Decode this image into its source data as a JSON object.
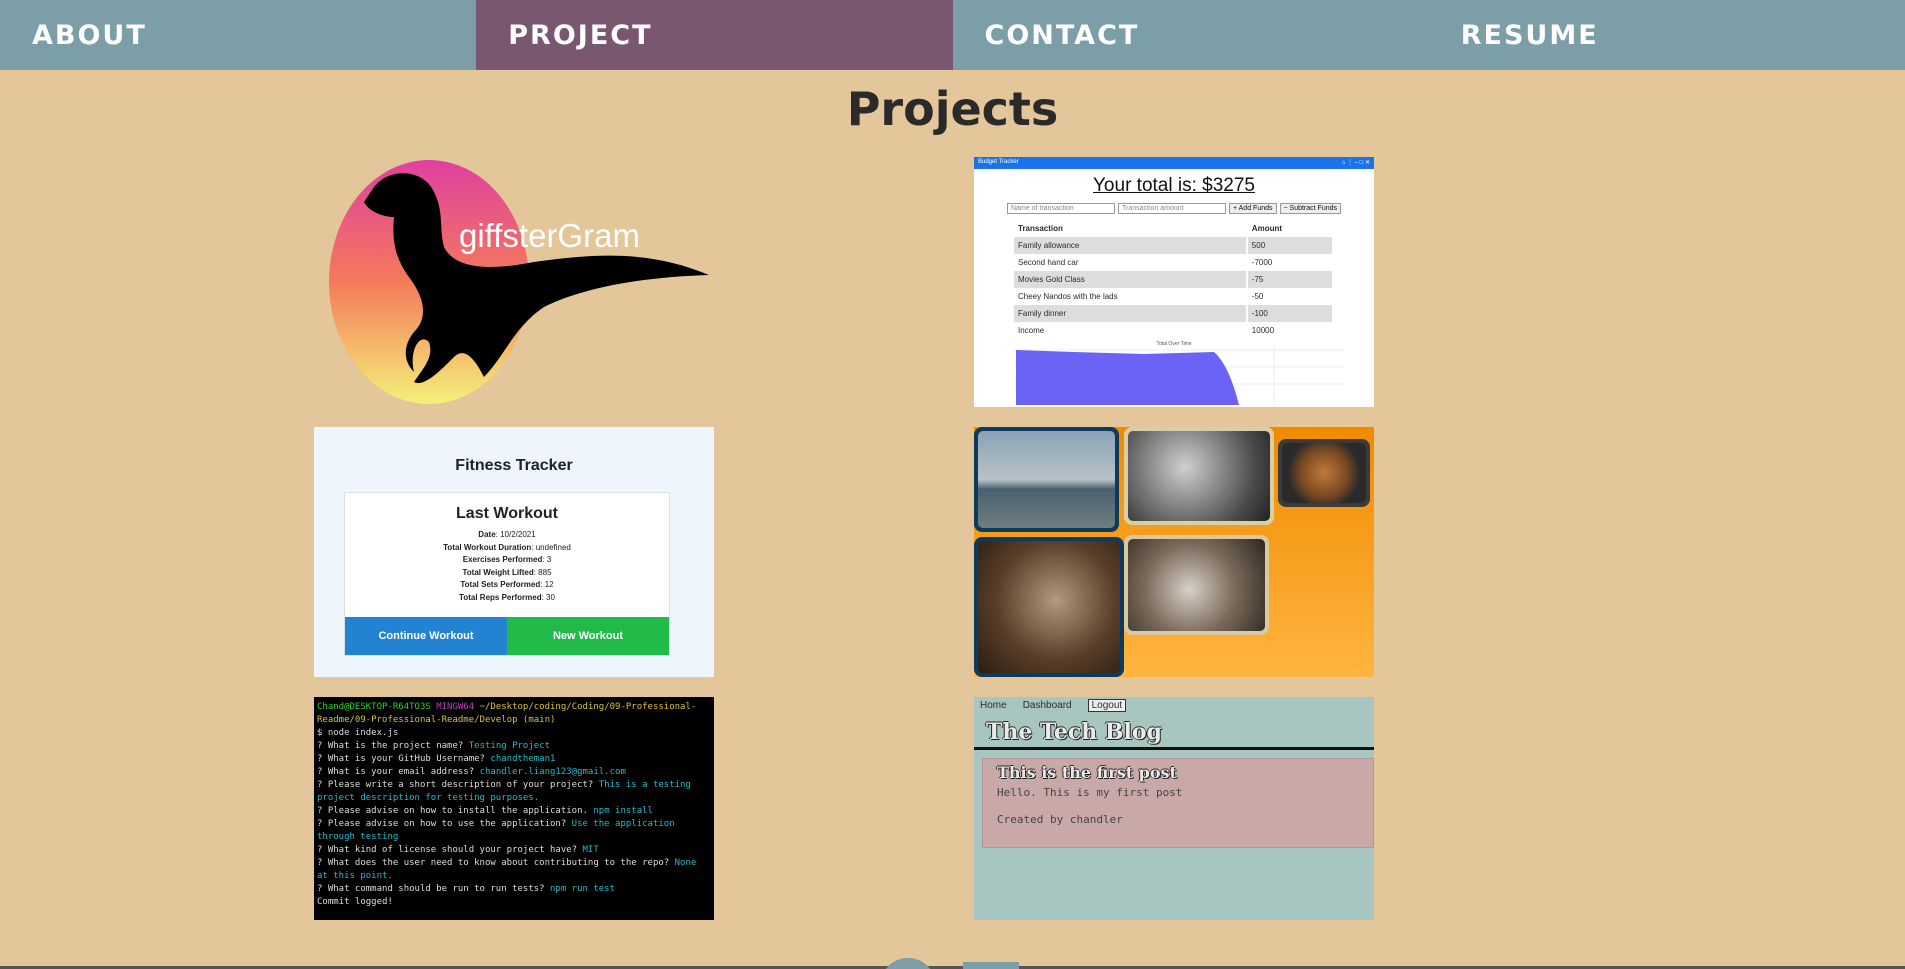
{
  "nav": {
    "items": [
      {
        "label": "ABOUT"
      },
      {
        "label": "PROJECT"
      },
      {
        "label": "CONTACT"
      },
      {
        "label": "RESUME"
      }
    ]
  },
  "page": {
    "title": "Projects"
  },
  "colors": {
    "nav_bg": "#7B9EA8",
    "nav_active": "#7A5770",
    "page_bg": "#E3C699"
  },
  "projects": {
    "giffstergram": {
      "logo_text": "giffsterGram"
    },
    "budget": {
      "window_title": "Budget Tracker",
      "total": "Your total is: $3275",
      "name_placeholder": "Name of transaction",
      "amount_placeholder": "Transaction amount",
      "add_label": "+ Add Funds",
      "subtract_label": "− Subtract Funds",
      "headers": [
        "Transaction",
        "Amount"
      ],
      "rows": [
        [
          "Family allowance",
          "500"
        ],
        [
          "Second hand car",
          "-7000"
        ],
        [
          "Movies Gold Class",
          "-75"
        ],
        [
          "Cheey Nandos with the lads",
          "-50"
        ],
        [
          "Family dinner",
          "-100"
        ],
        [
          "Income",
          "10000"
        ]
      ],
      "legend": "Total Over Time"
    },
    "fitness": {
      "title": "Fitness Tracker",
      "card_title": "Last Workout",
      "stats": [
        {
          "label": "Date",
          "value": "10/2/2021"
        },
        {
          "label": "Total Workout Duration",
          "value": "undefined"
        },
        {
          "label": "Exercises Performed",
          "value": "3"
        },
        {
          "label": "Total Weight Lifted",
          "value": "885"
        },
        {
          "label": "Total Sets Performed",
          "value": "12"
        },
        {
          "label": "Total Reps Performed",
          "value": "30"
        }
      ],
      "continue_label": "Continue Workout",
      "new_label": "New Workout"
    },
    "terminal": {
      "prompt_user": "Chand@DESKTOP-R64TO3S",
      "prompt_env": "MINGW64",
      "prompt_path": "~/Desktop/coding/Coding/09-Professional-Readme/09-Professional-Readme/Develop (main)",
      "command": "$ node index.js",
      "qa": [
        {
          "q": "? What is the project name?",
          "a": "Testing Project"
        },
        {
          "q": "? What is your GitHub Username?",
          "a": "chandtheman1"
        },
        {
          "q": "? What is your email address?",
          "a": "chandler.liang123@gmail.com"
        },
        {
          "q": "? Please write a short description of your project?",
          "a": "This is a testing project description for testing purposes."
        },
        {
          "q": "? Please advise on how to install the application.",
          "a": "npm install"
        },
        {
          "q": "? Please advise on how to use the application?",
          "a": "Use the application through testing"
        },
        {
          "q": "? What kind of license should your project have?",
          "a": "MIT"
        },
        {
          "q": "? What does the user need to know about contributing to the repo?",
          "a": "None at this point."
        },
        {
          "q": "? What command should be run to run tests?",
          "a": "npm run test"
        }
      ],
      "final": "Commit logged!"
    },
    "blog": {
      "nav": [
        "Home",
        "Dashboard"
      ],
      "logout": "Logout",
      "title": "The Tech Blog",
      "post_title": "This is the first post",
      "post_body": "Hello. This is my first post",
      "post_author": "Created by chandler"
    }
  }
}
